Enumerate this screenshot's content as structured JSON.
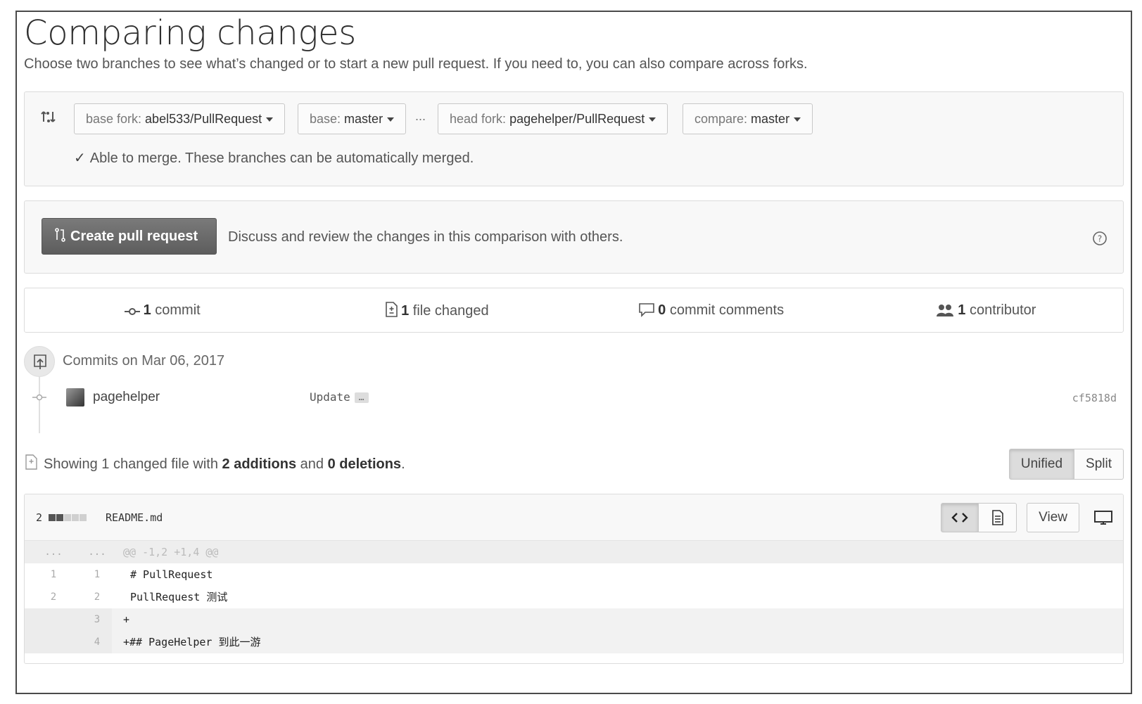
{
  "page": {
    "title": "Comparing changes",
    "description": "Choose two branches to see what’s changed or to start a new pull request. If you need to, you can also compare across forks."
  },
  "compare": {
    "base_fork_label": "base fork: ",
    "base_fork_value": "abel533/PullRequest",
    "base_label": "base: ",
    "base_value": "master",
    "separator": "...",
    "head_fork_label": "head fork: ",
    "head_fork_value": "pagehelper/PullRequest",
    "compare_label": "compare: ",
    "compare_value": "master",
    "merge_status": "Able to merge. These branches can be automatically merged."
  },
  "pull_request": {
    "button_label": "Create pull request",
    "description": "Discuss and review the changes in this comparison with others."
  },
  "stats": {
    "commits_count": "1",
    "commits_label": " commit",
    "files_count": "1",
    "files_label": " file changed",
    "comments_count": "0",
    "comments_label": " commit comments",
    "contributors_count": "1",
    "contributors_label": " contributor"
  },
  "commits": {
    "date_header": "Commits on Mar 06, 2017",
    "items": [
      {
        "author": "pagehelper",
        "message": "Update",
        "more": "…",
        "sha": "cf5818d"
      }
    ]
  },
  "diff_summary": {
    "prefix": "Showing ",
    "changed_files": "1 changed file",
    "mid": " with ",
    "additions": "2 additions",
    "and": " and ",
    "deletions": "0 deletions",
    "suffix": "."
  },
  "view_toggle": {
    "unified_label": "Unified",
    "split_label": "Split",
    "selected": "Unified"
  },
  "file": {
    "change_count": "2",
    "diffstat": {
      "additions": 2,
      "deletions": 0,
      "blocks": [
        "add",
        "add",
        "neutral",
        "neutral",
        "neutral"
      ]
    },
    "name": "README.md",
    "view_label": "View",
    "lines": [
      {
        "type": "hunk",
        "old": "...",
        "new": "...",
        "text": "@@ -1,2 +1,4 @@"
      },
      {
        "type": "ctx",
        "old": "1",
        "new": "1",
        "text": "# PullRequest"
      },
      {
        "type": "ctx",
        "old": "2",
        "new": "2",
        "text": "PullRequest 测试"
      },
      {
        "type": "add",
        "old": "",
        "new": "3",
        "text": "+"
      },
      {
        "type": "add",
        "old": "",
        "new": "4",
        "text": "+## PageHelper 到此一游"
      }
    ]
  },
  "icons": {
    "compare": "compare-arrows-icon",
    "check": "check-icon",
    "pull_request": "git-pull-request-icon",
    "help": "question-circle-icon",
    "commit": "git-commit-icon",
    "file_diff": "file-diff-icon",
    "comment": "comment-icon",
    "contributors": "people-icon",
    "repo_push": "repo-push-icon",
    "code": "code-icon",
    "file_text": "file-text-icon",
    "desktop": "device-desktop-icon"
  }
}
